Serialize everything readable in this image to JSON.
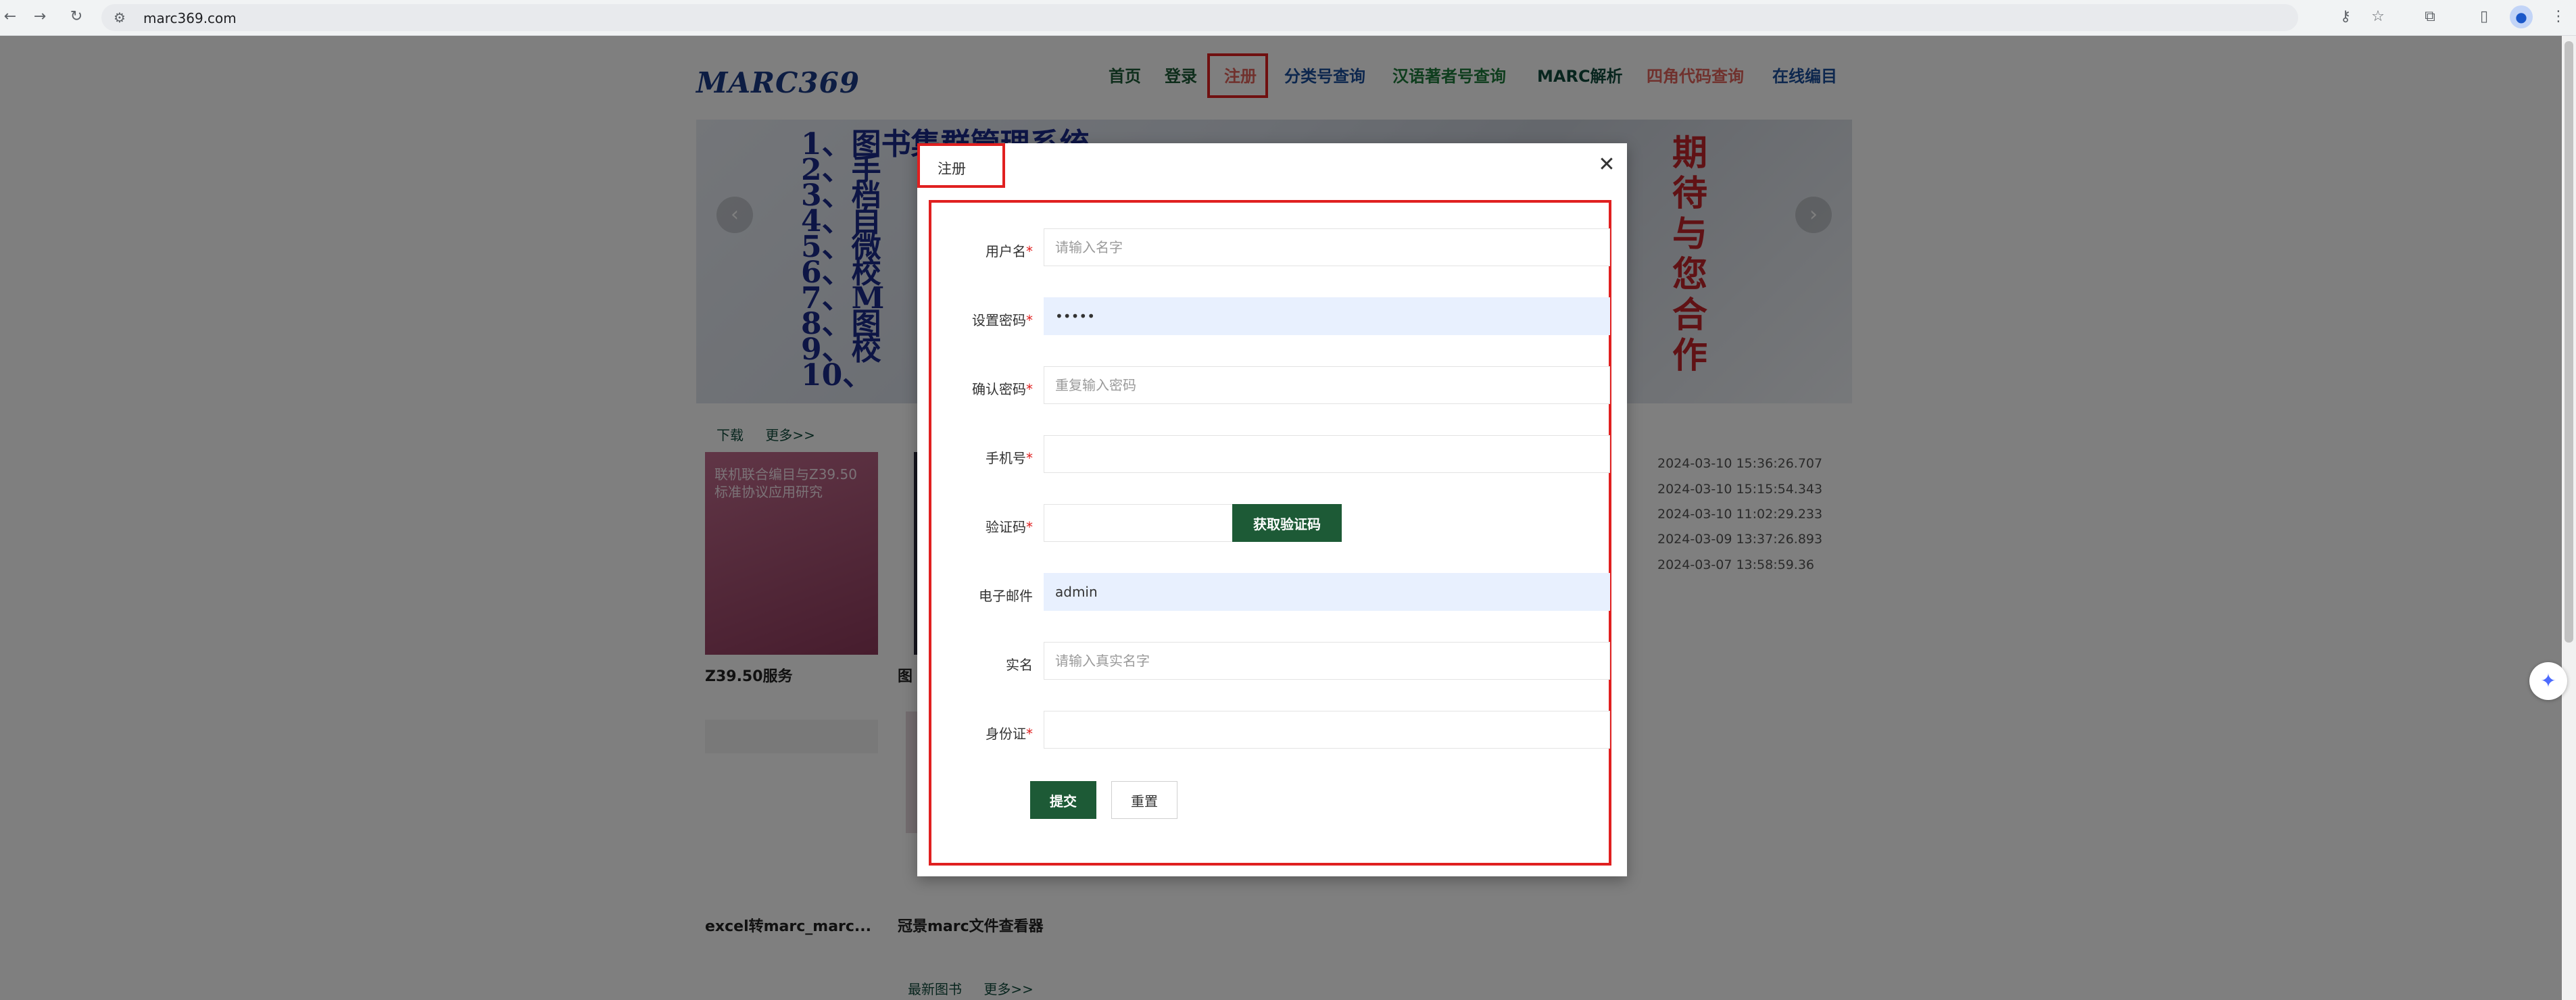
{
  "browser": {
    "url": "marc369.com",
    "back_icon": "←",
    "forward_icon": "→",
    "reload_icon": "↻",
    "site_icon": "⚙",
    "key_icon": "⚷",
    "star_icon": "☆",
    "extension_icon": "⧉",
    "sidepanel_icon": "▯",
    "profile_icon": "●",
    "menu_icon": "⋮"
  },
  "site": {
    "logo": "MARC369",
    "nav": [
      {
        "label": "首页",
        "color": "#1d5a36"
      },
      {
        "label": "登录",
        "color": "#1d5a36"
      },
      {
        "label": "注册",
        "color": "#e0625b"
      },
      {
        "label": "分类号查询",
        "color": "#1b4f9c"
      },
      {
        "label": "汉语著者号查询",
        "color": "#1d7a3a"
      },
      {
        "label": "MARC解析",
        "color": "#114b3c"
      },
      {
        "label": "四角代码查询",
        "color": "#e0625b"
      },
      {
        "label": "在线编目",
        "color": "#1b4f9c"
      }
    ],
    "banner_lines": [
      "1、图书集群管理系统",
      "2、手",
      "3、档",
      "4、自",
      "5、微",
      "6、校",
      "7、M",
      "8、图",
      "9、校",
      "10、"
    ],
    "banner_vertical": [
      "期",
      "待",
      "与",
      "您",
      "合",
      "作"
    ],
    "banner_prev": "‹",
    "banner_next": "›",
    "sub_tabs": [
      "下载",
      "更多>>"
    ],
    "news_times": [
      "2024-03-10 15:36:26.707",
      "2024-03-10 15:15:54.343",
      "2024-03-10 11:02:29.233",
      "2024-03-09 13:37:26.893",
      "2024-03-07 13:58:59.36"
    ],
    "books": [
      {
        "title": "Z39.50服务",
        "cover_text": "联机联合编目与Z39.50标准协议应用研究"
      },
      {
        "title": "图"
      }
    ],
    "books_row2": [
      "excel转marc_marc...",
      "冠景marc文件查看器"
    ],
    "bottom_tabs": [
      "最新图书",
      "更多>>"
    ],
    "side_fab_icon": "✦"
  },
  "modal": {
    "title": "注册",
    "close_icon": "✕",
    "fields": [
      {
        "label": "用户名",
        "required": true,
        "value": "",
        "placeholder": "请输入名字",
        "autofill": false
      },
      {
        "label": "设置密码",
        "required": true,
        "value": "•••••",
        "placeholder": "",
        "autofill": true
      },
      {
        "label": "确认密码",
        "required": true,
        "value": "",
        "placeholder": "重复输入密码",
        "autofill": false
      },
      {
        "label": "手机号",
        "required": true,
        "value": "",
        "placeholder": "",
        "autofill": false
      },
      {
        "label": "验证码",
        "required": true,
        "value": "",
        "placeholder": "",
        "autofill": false
      },
      {
        "label": "电子邮件",
        "required": false,
        "value": "admin",
        "placeholder": "",
        "autofill": true
      },
      {
        "label": "实名",
        "required": false,
        "value": "",
        "placeholder": "请输入真实名字",
        "autofill": false
      },
      {
        "label": "身份证",
        "required": true,
        "value": "",
        "placeholder": "",
        "autofill": false
      }
    ],
    "required_mark": "*",
    "get_code_label": "获取验证码",
    "submit_label": "提交",
    "reset_label": "重置"
  }
}
